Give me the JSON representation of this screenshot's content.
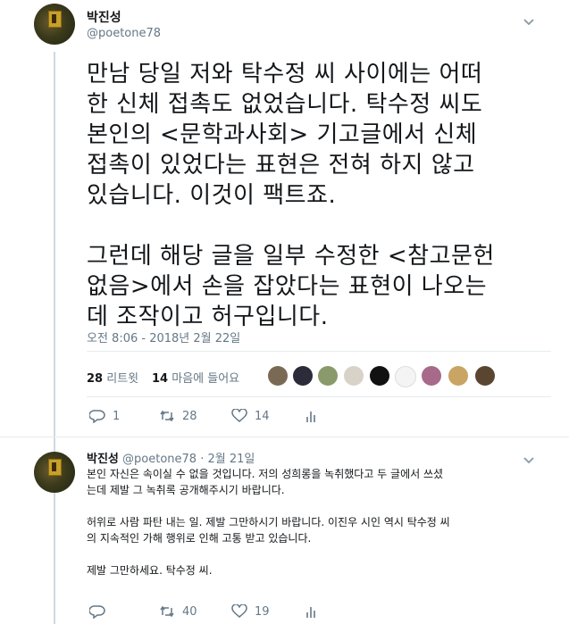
{
  "main_tweet": {
    "author_name": "박진성",
    "author_handle": "@poetone78",
    "body": "만남 당일 저와 탁수정 씨 사이에는 어떠\n한 신체 접촉도 없었습니다. 탁수정 씨도\n본인의 <문학과사회> 기고글에서 신체\n접촉이 있었다는 표현은 전혀 하지 않고\n있습니다. 이것이 팩트죠.\n\n그런데 해당 글을 일부 수정한 <참고문헌\n없음>에서 손을 잡았다는 표현이 나오는\n데 조작이고 허구입니다.",
    "timestamp": "오전 8:06 - 2018년 2월 22일",
    "retweet_count": "28",
    "retweet_label": "리트윗",
    "like_count": "14",
    "like_label": "마음에 들어요",
    "actions": {
      "reply": "1",
      "retweet": "28",
      "like": "14"
    }
  },
  "reply_tweet": {
    "author_name": "박진성",
    "author_handle": "@poetone78",
    "date": "· 2월 21일",
    "body": "본인 자신은 속이실 수 없을 것입니다. 저의 성희롱을 녹취했다고 두 글에서 쓰셨\n는데 제발 그 녹취록 공개해주시기 바랍니다.\n\n허위로 사람 파탄 내는 일. 제발 그만하시기 바랍니다. 이진우 시인 역시 탁수정 씨\n의 지속적인 가해 행위로 인해 고통 받고 있습니다.\n\n제발 그만하세요. 탁수정 씨.",
    "actions": {
      "reply": "",
      "retweet": "40",
      "like": "19"
    }
  },
  "colors": {
    "icon_gray": "#657786",
    "divider": "#e6ecf0",
    "thread_line": "#cfd9de"
  },
  "icons": [
    "reply-icon",
    "retweet-icon",
    "like-icon",
    "analytics-icon",
    "chevron-down-icon"
  ]
}
